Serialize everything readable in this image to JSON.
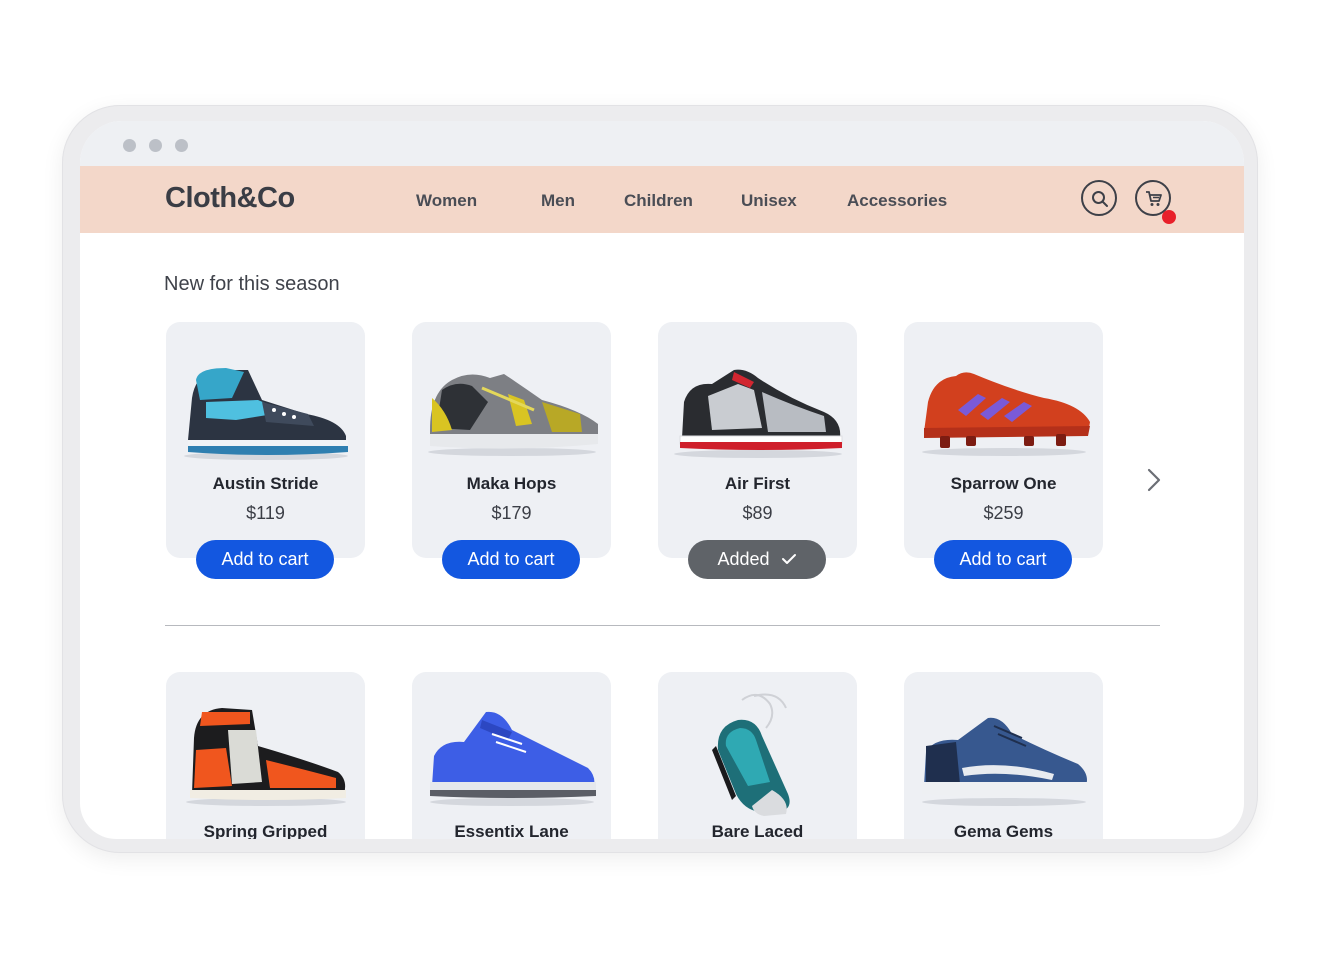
{
  "brand": {
    "logo": "Cloth&Co"
  },
  "nav": {
    "links": [
      "Women",
      "Men",
      "Children",
      "Unisex",
      "Accessories"
    ],
    "search_icon": "search-icon",
    "cart_icon": "cart-icon"
  },
  "section": {
    "title": "New for this season"
  },
  "products_row1": [
    {
      "name": "Austin Stride",
      "price": "$119",
      "button": "Add to cart",
      "added": false
    },
    {
      "name": "Maka Hops",
      "price": "$179",
      "button": "Add to cart",
      "added": false
    },
    {
      "name": "Air First",
      "price": "$89",
      "button": "Added",
      "added": true
    },
    {
      "name": "Sparrow One",
      "price": "$259",
      "button": "Add to cart",
      "added": false
    }
  ],
  "products_row2": [
    {
      "name": "Spring Gripped"
    },
    {
      "name": "Essentix Lane"
    },
    {
      "name": "Bare Laced"
    },
    {
      "name": "Gema Gems"
    }
  ],
  "colors": {
    "navbar": "#f3d7c9",
    "button_primary": "#1357e0",
    "button_added": "#5f6368",
    "cart_badge": "#e8202a"
  }
}
